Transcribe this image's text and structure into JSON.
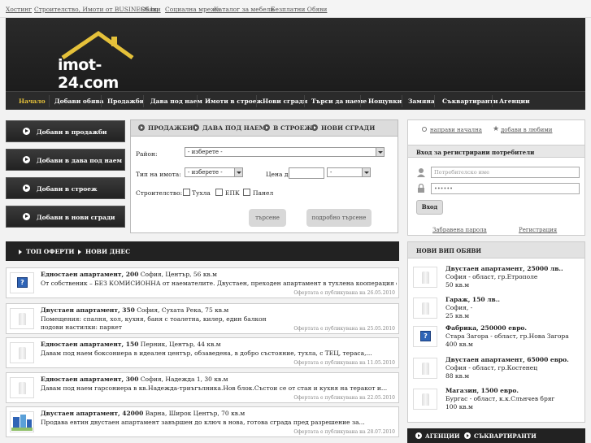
{
  "top_links": [
    "Хостинг",
    "Строителство, Имоти от BUSINESS.bg",
    "Обяви",
    "Социална мрежа",
    "Каталог за мебели",
    "Безплатни Обяви"
  ],
  "logo": "imot-24.com",
  "nav": [
    "Начало",
    "Добави обява",
    "Продажби",
    "Дава под наем",
    "Имоти в строеж",
    "Нови сгради",
    "Търси да наеме",
    "Нощувки",
    "Замяна",
    "Съквартиранти",
    "Агенции"
  ],
  "left_buttons": [
    "Добави в продажби",
    "Добави в дава под наем",
    "Добави в строеж",
    "Добави в нови сгради"
  ],
  "search": {
    "tabs": [
      "ПРОДАЖБИ",
      "ДАВА ПОД НАЕМ",
      "В СТРОЕЖ",
      "НОВИ СГРАДИ"
    ],
    "region_label": "Район:",
    "region_value": "- изберете -",
    "type_label": "Тип на имота:",
    "type_value": "- изберете -",
    "price_label": "Цена до:",
    "currency_value": "-",
    "construction_label": "Строителство:",
    "construction_options": [
      "Тухла",
      "ЕПК",
      "Панел"
    ],
    "search_button": "търсене",
    "advanced_button": "подробно търсене"
  },
  "offer_tabs": [
    "ТОП ОФЕРТИ",
    "НОВИ ДНЕС"
  ],
  "listings": [
    {
      "title": "Едностаен апартамент, 200",
      "location": " София, Център, 56 кв.м",
      "desc": [
        "От собственик – БЕЗ КОМИСИОННА от наемателите. Двустаен, преходен апартамент в тухлена кооперация от..."
      ],
      "date": "Офертата е публикувана на 26.05.2010",
      "thumb": "question"
    },
    {
      "title": "Двустаен апартамент, 350",
      "location": " София, Сухата Река, 75 кв.м",
      "desc": [
        "Помещения: спалня, хол, кухня, баня с тоалетна, килер, един балкон",
        "подови настилки: паркет"
      ],
      "date": "Офертата е публикувана на 25.05.2010",
      "thumb": "placeholder"
    },
    {
      "title": "Едностаен апартамент, 150",
      "location": " Перник, Център, 44 кв.м",
      "desc": [
        "Давам под наем боксониера в идеален център, обзаведена, в добро състояние, тухла, с ТЕЦ, тераса,..."
      ],
      "date": "Офертата е публикувана на 11.05.2010",
      "thumb": "placeholder"
    },
    {
      "title": "Едностаен апартамент, 300",
      "location": " София, Надежда 1, 30 кв.м",
      "desc": [
        "Давам под наем гарсониера в кв.Надежда-триъгълника.Нов блок.Състои се от стая и кухня на теракот и..."
      ],
      "date": "Офертата е публикувана на 22.05.2010",
      "thumb": "placeholder"
    },
    {
      "title": "Двустаен апартамент, 42000",
      "location": " Варна, Широк Център, 70 кв.м",
      "desc": [
        "Продава евтин двустаен апартамент завършен до ключ в нова, готова сграда пред разрешение за..."
      ],
      "date": "Офертата е публикувана на 28.07.2010",
      "thumb": "building"
    }
  ],
  "right": {
    "home_link": "направи начална",
    "fav_link": "добави в любими",
    "login_title": "Вход за регистрирани потребители",
    "user_placeholder": "Потребителско име",
    "pass_value": "••••••",
    "login_button": "Вход",
    "forgot_link": "Забравена парола",
    "register_link": "Регистрация",
    "vip_title": "НОВИ ВИП ОБЯВИ",
    "vip": [
      {
        "title": "Двустаен апартамент, 25000 лв..",
        "line2": "София - област, гр.Етрополе",
        "line3": "50 кв.м",
        "thumb": "placeholder"
      },
      {
        "title": "Гараж, 150 лв..",
        "line2": "София, -",
        "line3": "25 кв.м",
        "thumb": "placeholder"
      },
      {
        "title": "Фабрика, 250000 евро.",
        "line2": "Стара Загора - област, гр.Нова Загора",
        "line3": "400 кв.м",
        "thumb": "question"
      },
      {
        "title": "Двустаен апартамент, 65000 евро.",
        "line2": "София - област, гр.Костенец",
        "line3": "88 кв.м",
        "thumb": "placeholder"
      },
      {
        "title": "Магазин, 1500 евро.",
        "line2": "Бургас - област, к.к.Слънчев бряг",
        "line3": "100 кв.м",
        "thumb": "placeholder"
      }
    ],
    "bottom_tabs": [
      "АГЕНЦИИ",
      "СЪКВАРТИРАНТИ"
    ]
  },
  "colors": {
    "accent": "#e5c13a",
    "header": "#222222",
    "question_icon": "#2f64b6"
  }
}
